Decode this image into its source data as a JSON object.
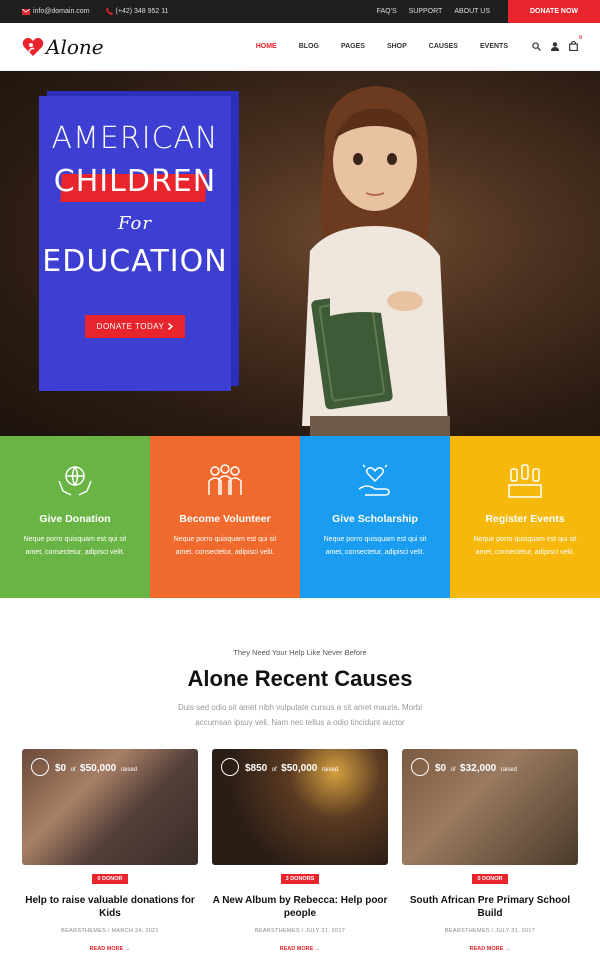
{
  "topbar": {
    "email": "info@domain.com",
    "phone": "(+42) 348 952 11",
    "links": [
      "FAQ'S",
      "SUPPORT",
      "ABOUT US"
    ],
    "donate_label": "DONATE NOW"
  },
  "navbar": {
    "logo_text": "Alone",
    "items": [
      "HOME",
      "BLOG",
      "PAGES",
      "SHOP",
      "CAUSES",
      "EVENTS"
    ],
    "active": "HOME",
    "cart_count": "0"
  },
  "hero": {
    "line1": "AMERICAN",
    "line2": "CHILDREN",
    "line3": "For",
    "line4": "EDUCATION",
    "button_label": "DONATE TODAY"
  },
  "features": [
    {
      "title": "Give Donation",
      "desc": "Neque porro quisquam est qui sit amet, consectetur, adipisci velit.",
      "icon": "globe-hands-icon"
    },
    {
      "title": "Become Volunteer",
      "desc": "Neque porro quisquam est qui sit amet, consectetur, adipisci velit.",
      "icon": "volunteers-icon"
    },
    {
      "title": "Give Scholarship",
      "desc": "Neque porro quisquam est qui sit amet, consectetur, adipisci velit.",
      "icon": "heart-hand-icon"
    },
    {
      "title": "Register Events",
      "desc": "Neque porro quisquam est qui sit amet, consectetur, adipisci velit.",
      "icon": "raised-hands-icon"
    }
  ],
  "causes": {
    "eyebrow": "They Need Your Help Like Never Before",
    "title": "Alone Recent Causes",
    "subtitle_line1": "Duis sed odio sit amet nibh vulputate cursus a sit amet mauris. Morbi",
    "subtitle_line2": "accumsan ipsuy veli. Nam nec tellus a odio tincidunt auctor",
    "cards": [
      {
        "raised": "$0",
        "goal": "$50,000",
        "of": "of",
        "raised_label": "raised",
        "donors": "0 DONOR",
        "title": "Help to raise valuable donations for Kids",
        "meta": "BEARSTHEMES / MARCH 24, 2021",
        "more": "READ MORE →"
      },
      {
        "raised": "$850",
        "goal": "$50,000",
        "of": "of",
        "raised_label": "raised",
        "donors": "3 DONORS",
        "title": "A New Album by Rebecca: Help poor people",
        "meta": "BEARSTHEMES / JULY 31, 2017",
        "more": "READ MORE →"
      },
      {
        "raised": "$0",
        "goal": "$32,000",
        "of": "of",
        "raised_label": "raised",
        "donors": "0 DONOR",
        "title": "South African Pre Primary School Build",
        "meta": "BEARSTHEMES / JULY 31, 2017",
        "more": "READ MORE →"
      }
    ]
  },
  "colors": {
    "accent": "#e8242d",
    "green": "#6ab445",
    "orange": "#ef6a2c",
    "blue": "#1a9df0",
    "yellow": "#f6b80d",
    "hero_card": "#3c3fd1"
  }
}
